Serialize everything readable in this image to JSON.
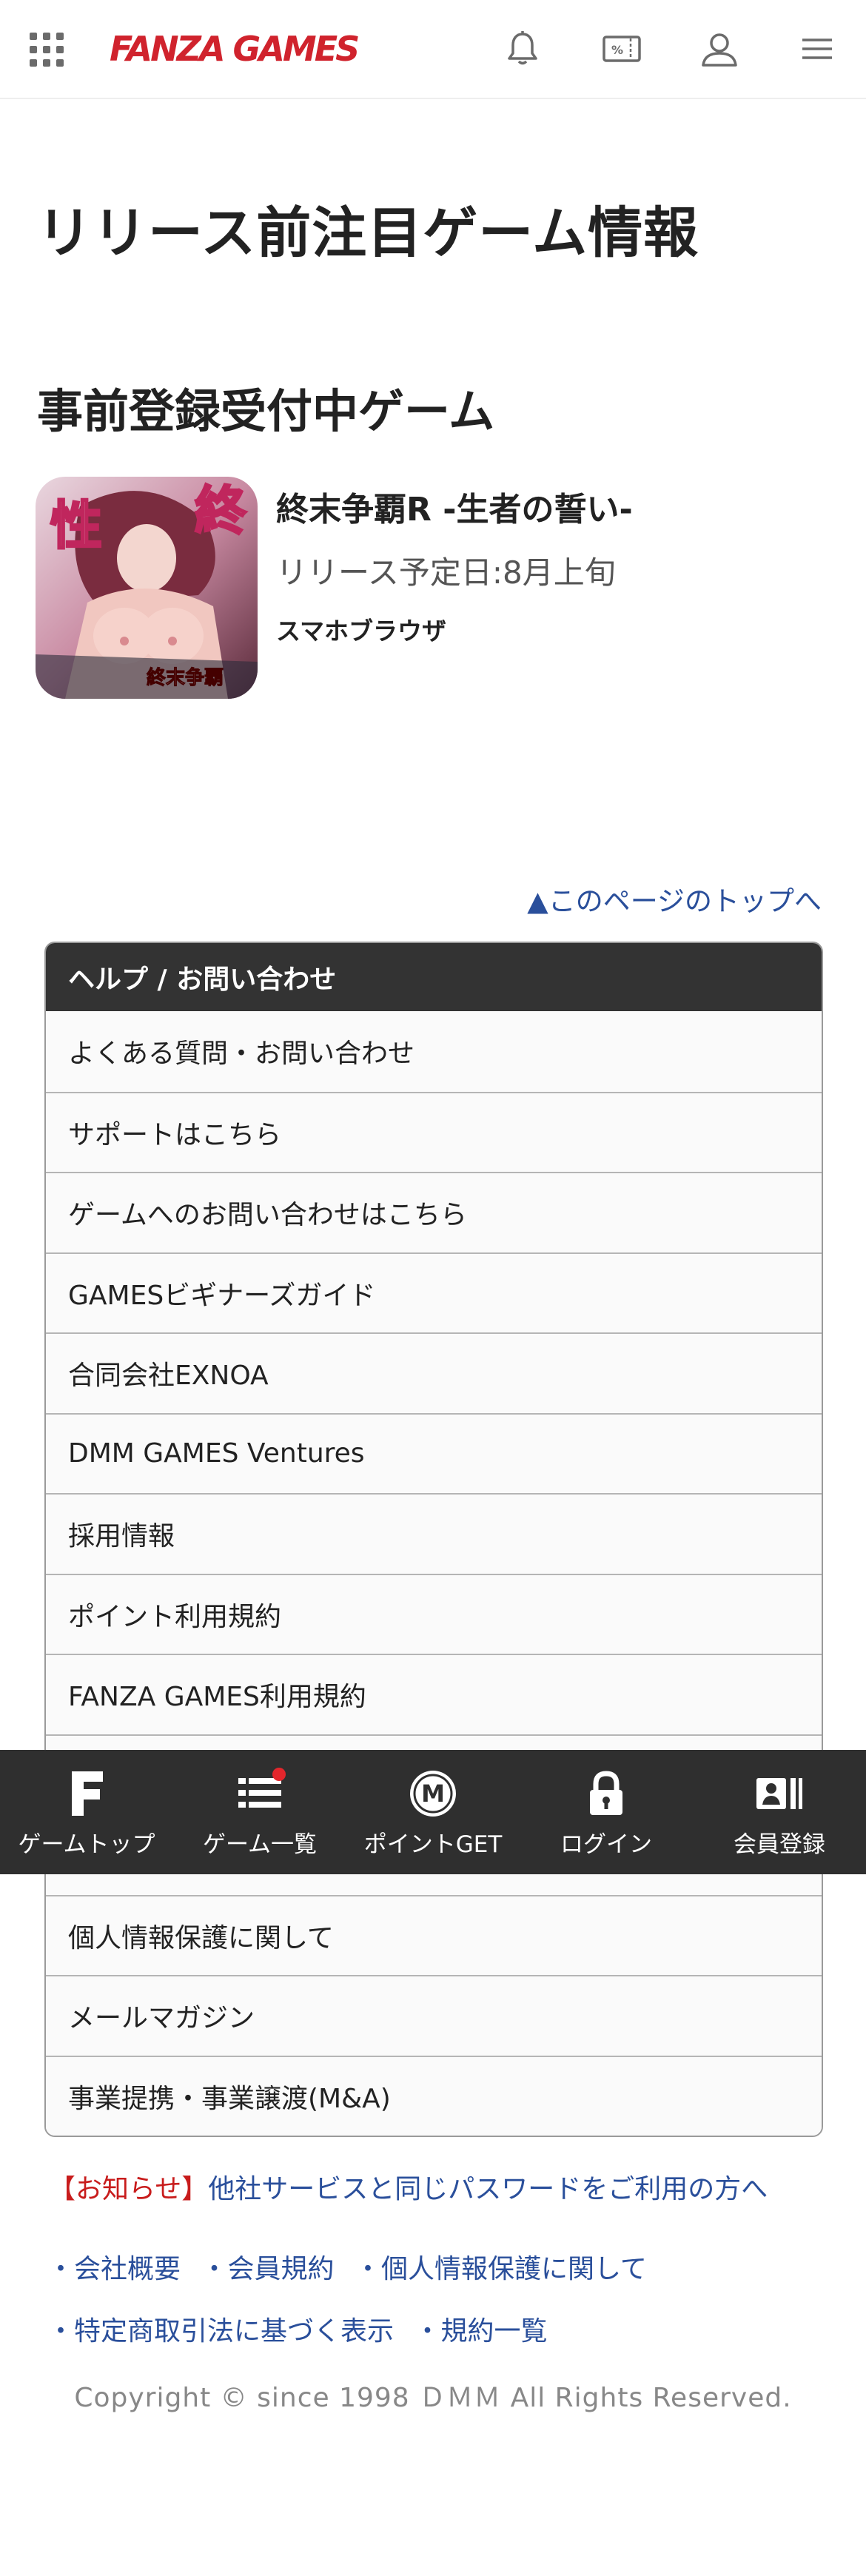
{
  "header": {
    "logo": "FANZA GAMES",
    "menu_icon": "grid-menu-icon",
    "icons": [
      "bell-icon",
      "coupon-icon",
      "user-icon",
      "hamburger-menu-icon"
    ]
  },
  "page_title": "リリース前注目ゲーム情報",
  "section_title": "事前登録受付中ゲーム",
  "game": {
    "name": "終末争覇R -生者の誓い-",
    "release": "リリース予定日:8月上旬",
    "platform": "スマホブラウザ"
  },
  "pagetop_label": "▲このページのトップへ",
  "help": {
    "title": "ヘルプ / お問い合わせ",
    "items": [
      "よくある質問・お問い合わせ",
      "サポートはこちら",
      "ゲームへのお問い合わせはこちら",
      "GAMESビギナーズガイド",
      "合同会社EXNOA",
      "DMM GAMES Ventures",
      "採用情報",
      "ポイント利用規約",
      "FANZA GAMES利用規約",
      "",
      "",
      "個人情報保護に関して",
      "メールマガジン",
      "事業提携・事業譲渡(M&A)"
    ]
  },
  "notice": {
    "tag": "【お知らせ】",
    "message": "他社サービスと同じパスワードをご利用の方へ"
  },
  "footer_links": {
    "row1": [
      "・会社概要",
      "・会員規約",
      "・個人情報保護に関して"
    ],
    "row2": [
      "・特定商取引法に基づく表示",
      "・規約一覧"
    ]
  },
  "copyright": "Copyright © since 1998 ＤＭＭ All Rights Reserved.",
  "bottom_nav": [
    {
      "label": "ゲームトップ",
      "icon": "f-logo-icon"
    },
    {
      "label": "ゲーム一覧",
      "icon": "list-icon"
    },
    {
      "label": "ポイントGET",
      "icon": "point-coin-icon"
    },
    {
      "label": "ログイン",
      "icon": "lock-icon"
    },
    {
      "label": "会員登録",
      "icon": "member-card-icon"
    }
  ],
  "colors": {
    "brand": "#d0232d",
    "link": "#2a4f9b",
    "notice": "#c81c1c",
    "dark_bar": "#2f2f2f",
    "help_header": "#333333"
  }
}
